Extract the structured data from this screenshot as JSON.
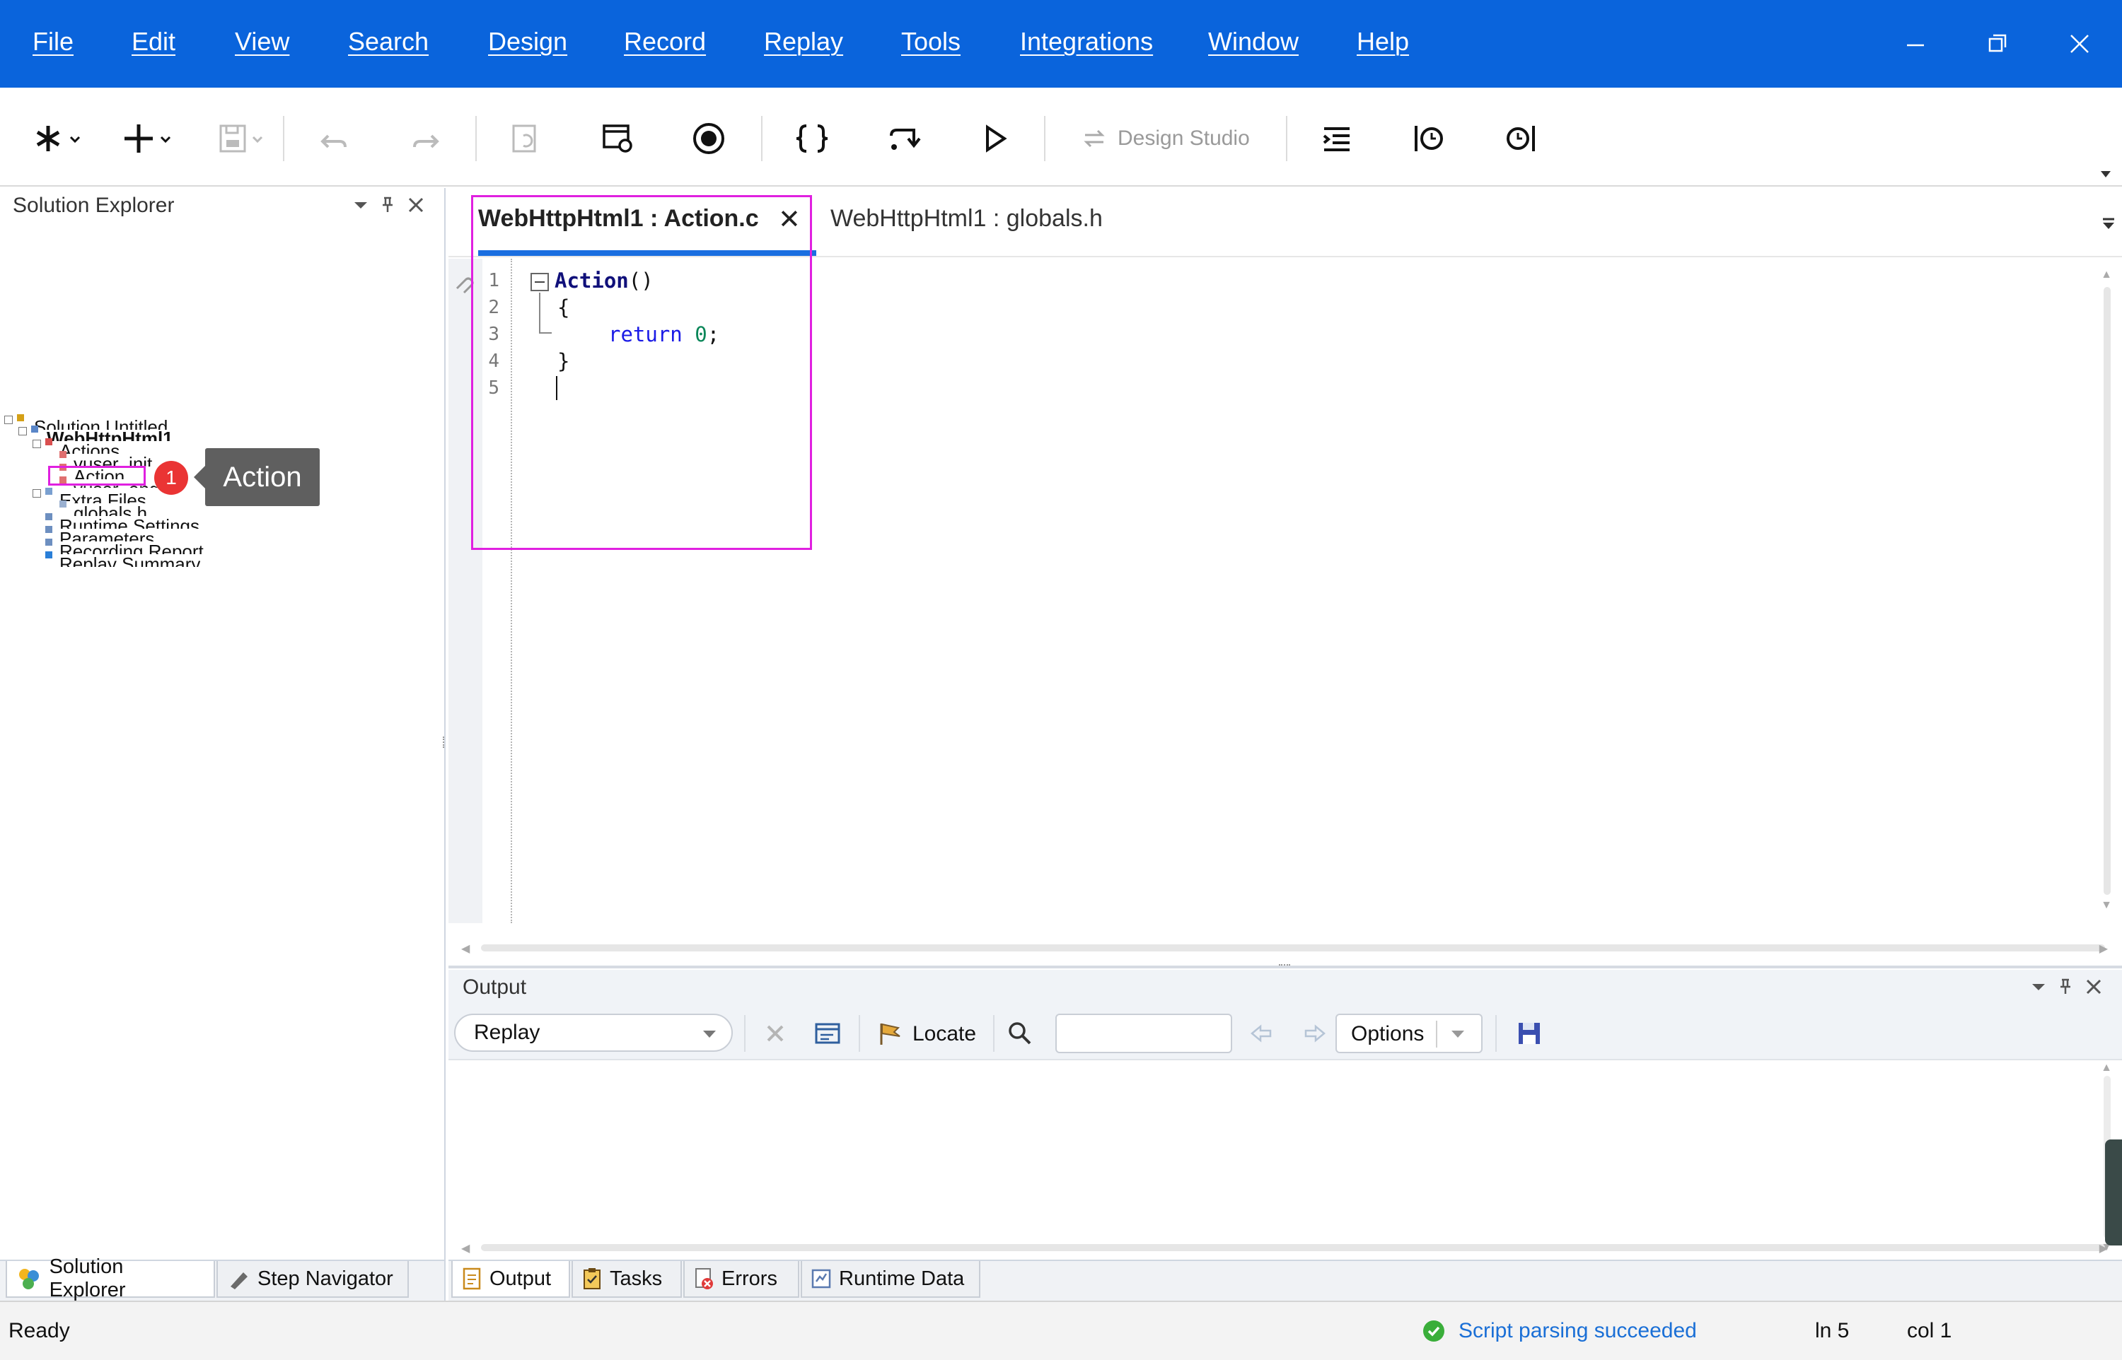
{
  "menu": {
    "items": [
      "File",
      "Edit",
      "View",
      "Search",
      "Design",
      "Record",
      "Replay",
      "Tools",
      "Integrations",
      "Window",
      "Help"
    ]
  },
  "toolbar": {
    "design_studio_label": "Design Studio"
  },
  "solution_explorer": {
    "title": "Solution Explorer",
    "tree": [
      "Solution Untitled",
      "WebHttpHtml1",
      "Actions",
      "vuser_init",
      "Action",
      "vuser_end",
      "Extra Files",
      "globals.h",
      "Runtime Settings",
      "Parameters",
      "Recording Report",
      "Replay Summary"
    ],
    "step_badge": "1",
    "tooltip": "Action",
    "tabs": [
      "Solution Explorer",
      "Step Navigator"
    ]
  },
  "editor": {
    "tabs": [
      {
        "label": "WebHttpHtml1 : Action.c",
        "close": "✕"
      },
      {
        "label": "WebHttpHtml1 : globals.h"
      }
    ],
    "line_numbers": [
      "1",
      "2",
      "3",
      "4",
      "5"
    ],
    "code": {
      "fn_name": "Action",
      "fn_parens": "()",
      "open_brace": "{",
      "return_kw": "return",
      "return_val": "0",
      "semicolon": ";",
      "close_brace": "}"
    }
  },
  "output": {
    "title": "Output",
    "source_selected": "Replay",
    "locate_label": "Locate",
    "search_value": "",
    "options_label": "Options",
    "tabs": [
      "Output",
      "Tasks",
      "Errors",
      "Runtime Data"
    ]
  },
  "status": {
    "text": "Ready",
    "parse_message": "Script parsing succeeded",
    "line": "ln 5",
    "col": "col 1"
  },
  "colors": {
    "menubar": "#0a64dc",
    "accent_tab": "#1a6ee0",
    "highlight": "#e020e0",
    "badge": "#ea3434",
    "success": "#3aae3a",
    "status_link": "#1a6fd6"
  }
}
